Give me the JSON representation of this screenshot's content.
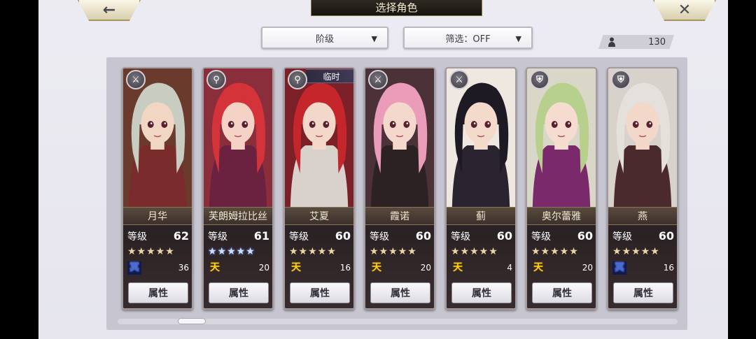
{
  "header": {
    "title": "选择角色",
    "back_symbol": "←",
    "close_symbol": "✕"
  },
  "filters": {
    "rank_label": "阶级",
    "filter_label": "筛选：OFF",
    "caret": "▼"
  },
  "roster_count": "130",
  "attr_button_label": "属性",
  "level_label": "等级",
  "colors": {
    "name_text": "#f4ead2",
    "gold_star": "#e8d8a8",
    "blue_star": "#cfe0ff",
    "tian_rank": "#ffd11a",
    "ming_rank": "#3d63d6"
  },
  "characters": [
    {
      "name": "月华",
      "level": "62",
      "stars": "★★★★★",
      "star_style": "gold",
      "rank_glyph": "冥",
      "rank_type": "ming",
      "rank_value": "36",
      "class_icon": "sword-icon",
      "class_symbol": "⚔",
      "hair": "#c9ccc0",
      "skin": "#f2d6c4",
      "outfit": "#7a2b2b",
      "bg": "#6a3a2c"
    },
    {
      "name": "芙朗姆拉比丝",
      "level": "61",
      "stars": "★★★★★",
      "star_style": "blue",
      "rank_glyph": "天",
      "rank_type": "tian",
      "rank_value": "20",
      "class_icon": "staff-icon",
      "class_symbol": "⚲",
      "hair": "#d4333a",
      "skin": "#f4d2c6",
      "outfit": "#6a2240",
      "bg": "#8a2e3c"
    },
    {
      "name": "艾夏",
      "level": "60",
      "stars": "★★★★★",
      "star_style": "gold",
      "rank_glyph": "天",
      "rank_type": "tian",
      "rank_value": "16",
      "class_icon": "staff-icon",
      "class_symbol": "⚲",
      "hair": "#c4262c",
      "skin": "#f3d7c8",
      "outfit": "#d9d2cc",
      "bg": "#7a2026",
      "temp_label": "临时"
    },
    {
      "name": "霞诺",
      "level": "60",
      "stars": "★★★★★",
      "star_style": "gold",
      "rank_glyph": "天",
      "rank_type": "tian",
      "rank_value": "20",
      "class_icon": "sword-icon",
      "class_symbol": "⚔",
      "hair": "#ea9cb8",
      "skin": "#f5d8cc",
      "outfit": "#2c2224",
      "bg": "#4a3238"
    },
    {
      "name": "蓟",
      "level": "60",
      "stars": "★★★★★",
      "star_style": "gold",
      "rank_glyph": "天",
      "rank_type": "tian",
      "rank_value": "4",
      "class_icon": "sword-icon",
      "class_symbol": "⚔",
      "hair": "#1e1a24",
      "skin": "#f4dacb",
      "outfit": "#2a2430",
      "bg": "#efe8e0"
    },
    {
      "name": "奥尔蕾雅",
      "level": "60",
      "stars": "★★★★★",
      "star_style": "gold",
      "rank_glyph": "天",
      "rank_type": "tian",
      "rank_value": "20",
      "class_icon": "shield-icon",
      "class_symbol": "⛨",
      "hair": "#b8d08e",
      "skin": "#f5dccf",
      "outfit": "#7a2a6a",
      "bg": "#d9d8c8"
    },
    {
      "name": "燕",
      "level": "60",
      "stars": "★★★★★",
      "star_style": "gold",
      "rank_glyph": "冥",
      "rank_type": "ming",
      "rank_value": "16",
      "class_icon": "shield-icon",
      "class_symbol": "⛨",
      "hair": "#e4e0dc",
      "skin": "#f3d8c9",
      "outfit": "#4a2a2c",
      "bg": "#d8d2cc"
    }
  ]
}
